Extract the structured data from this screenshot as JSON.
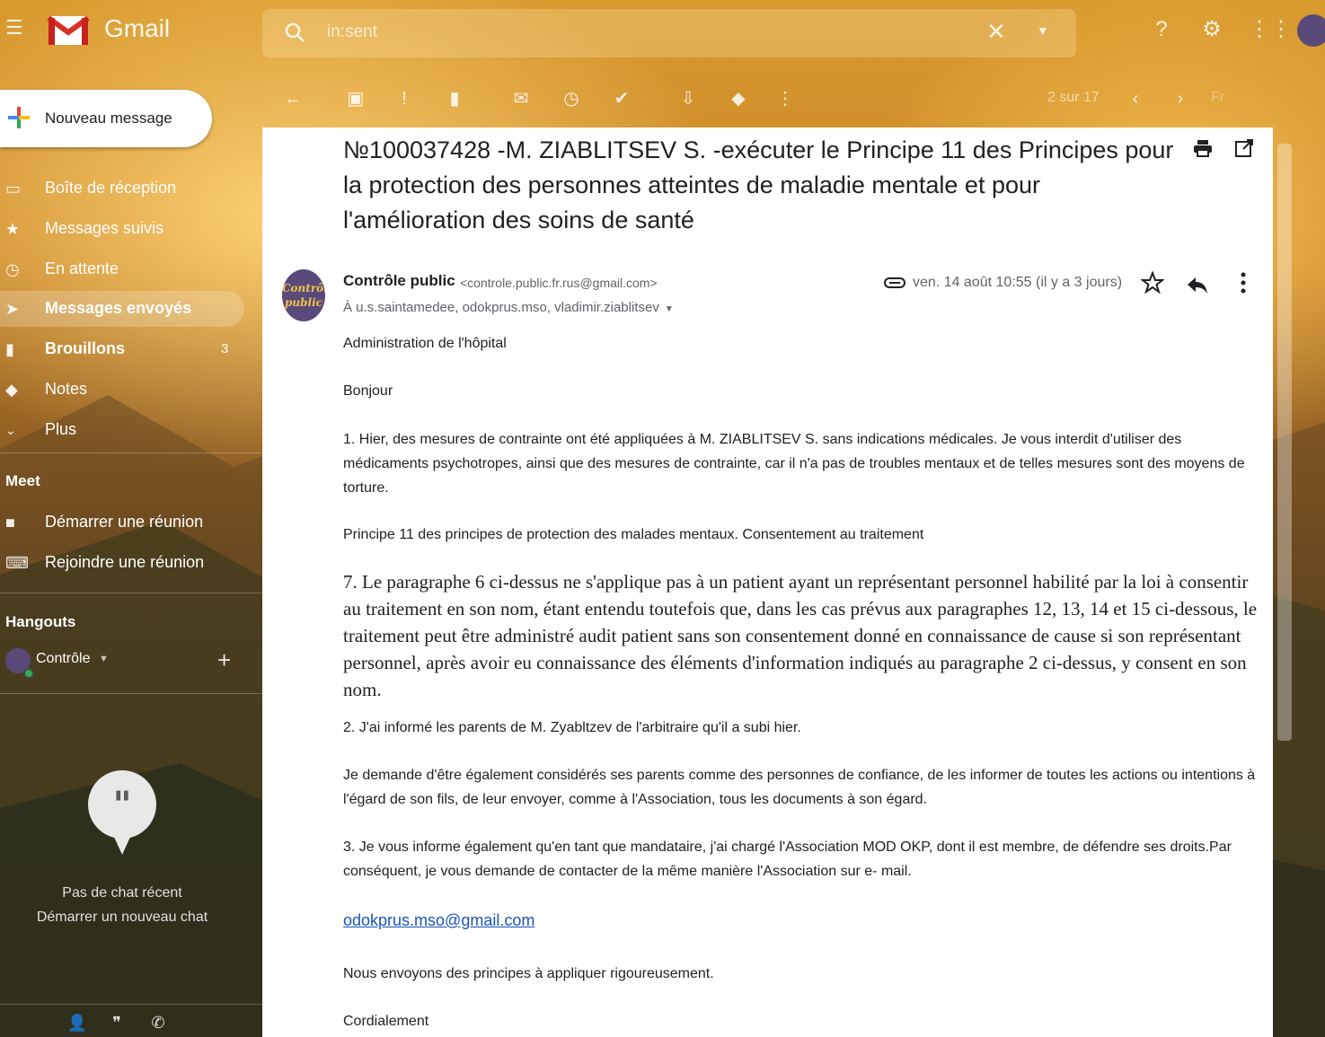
{
  "app": {
    "brand": "Gmail",
    "accent_red": "#d93025",
    "link_color": "#1a55b8"
  },
  "search": {
    "query": "in:sent"
  },
  "sidebar": {
    "compose_label": "Nouveau message",
    "items": [
      {
        "label": "Boîte de réception",
        "icon": "inbox-icon",
        "count": "",
        "active": false,
        "bold": false
      },
      {
        "label": "Messages suivis",
        "icon": "star-icon",
        "count": "",
        "active": false,
        "bold": false
      },
      {
        "label": "En attente",
        "icon": "clock-icon",
        "count": "",
        "active": false,
        "bold": false
      },
      {
        "label": "Messages envoyés",
        "icon": "send-icon",
        "count": "",
        "active": true,
        "bold": true
      },
      {
        "label": "Brouillons",
        "icon": "draft-icon",
        "count": "3",
        "active": false,
        "bold": true
      },
      {
        "label": "Notes",
        "icon": "label-icon",
        "count": "",
        "active": false,
        "bold": false
      },
      {
        "label": "Plus",
        "icon": "chevron-down-icon",
        "count": "",
        "active": false,
        "bold": false
      }
    ],
    "meet_title": "Meet",
    "meet_items": [
      "Démarrer une réunion",
      "Rejoindre une réunion"
    ],
    "hangouts_title": "Hangouts",
    "hangout_user": "Contrôle",
    "no_chat": "Pas de chat récent",
    "start_chat": "Démarrer un nouveau chat"
  },
  "toolbar": {
    "count": "2 sur 17",
    "lang": "Fr"
  },
  "message": {
    "subject": "№100037428 -M. ZIABLITSEV S. -exécuter le Principe 11 des Principes pour la protection des personnes atteintes de maladie mentale et pour l'amélioration des soins de santé",
    "avatar_line1": "Contrôle",
    "avatar_line2": "public",
    "sender_name": "Contrôle public",
    "sender_email": "<controle.public.fr.rus@gmail.com>",
    "recipients": "À u.s.saintamedee, odokprus.mso, vladimir.ziablitsev",
    "date": "ven. 14 août 10:55 (il y a 3 jours)",
    "paragraphs": [
      "Administration de l'hôpital",
      "Bonjour",
      "1. Hier, des mesures de contrainte ont été appliquées à M. ZIABLITSEV S.  sans indications médicales. Je vous interdit d'utiliser des médicaments psychotropes, ainsi que des mesures de contrainte, car il n'a pas de troubles mentaux et de telles mesures sont des moyens de torture.",
      "Principe 11 des principes de protection des malades mentaux. Consentement au traitement",
      "7. Le paragraphe 6 ci-dessus ne s'applique pas à un patient ayant un représentant personnel habilité par la loi à consentir au traitement en son nom, étant entendu toutefois que, dans les cas prévus aux paragraphes 12, 13, 14 et 15 ci-dessous, le traitement peut être administré audit patient sans son consentement donné en connaissance de cause si son représentant personnel, après avoir eu connaissance des éléments d'information indiqués au paragraphe 2 ci-dessus, y consent en son nom.",
      "2. J'ai informé les parents de M. Zyabltzev de l'arbitraire qu'il a subi hier.",
      "Je demande d'être également considérés  ses parents comme des personnes de confiance, de les informer de toutes les actions ou intentions à l'égard de son fils, de leur envoyer, comme à l'Association, tous les documents à son égard.",
      "3. Je vous informe également qu'en tant que mandataire, j'ai chargé l'Association MOD OKP, dont il est membre, de défendre ses droits.Par conséquent, je vous demande de contacter de la même manière l'Association sur e- mail.",
      "odokprus.mso@gmail.com",
      "Nous envoyons des principes à appliquer rigoureusement.",
      "Cordialement"
    ]
  }
}
